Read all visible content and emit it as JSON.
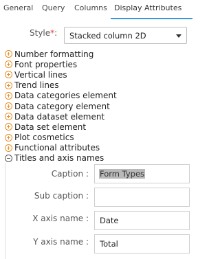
{
  "tabs": [
    {
      "label": "General"
    },
    {
      "label": "Query"
    },
    {
      "label": "Columns"
    },
    {
      "label": "Display Attributes"
    }
  ],
  "active_tab": "Display Attributes",
  "style": {
    "label": "Style",
    "required_mark": "*",
    "colon": ":",
    "value": "Stacked column 2D"
  },
  "sections": [
    {
      "label": "Number formatting",
      "icon": "plus-circle-icon"
    },
    {
      "label": "Font properties",
      "icon": "plus-circle-icon"
    },
    {
      "label": "Vertical lines",
      "icon": "plus-circle-icon"
    },
    {
      "label": "Trend lines",
      "icon": "plus-circle-icon"
    },
    {
      "label": "Data categories element",
      "icon": "plus-circle-icon"
    },
    {
      "label": "Data category element",
      "icon": "plus-circle-icon"
    },
    {
      "label": "Data dataset element",
      "icon": "plus-circle-icon"
    },
    {
      "label": "Data set element",
      "icon": "plus-circle-icon"
    },
    {
      "label": "Plot cosmetics",
      "icon": "plus-circle-icon"
    },
    {
      "label": "Functional attributes",
      "icon": "plus-circle-icon"
    },
    {
      "label": "Titles and axis names",
      "icon": "minus-circle-icon"
    }
  ],
  "titles_panel": {
    "caption": {
      "label": "Caption :",
      "value": "Form Types"
    },
    "subcaption": {
      "label": "Sub caption :",
      "value": ""
    },
    "xaxis": {
      "label": "X axis name :",
      "value": "Date"
    },
    "yaxis": {
      "label": "Y axis name :",
      "value": "Total"
    }
  },
  "colors": {
    "accent": "#3a9ad9",
    "expand_icon": "#e8902c",
    "required": "#e53935"
  }
}
